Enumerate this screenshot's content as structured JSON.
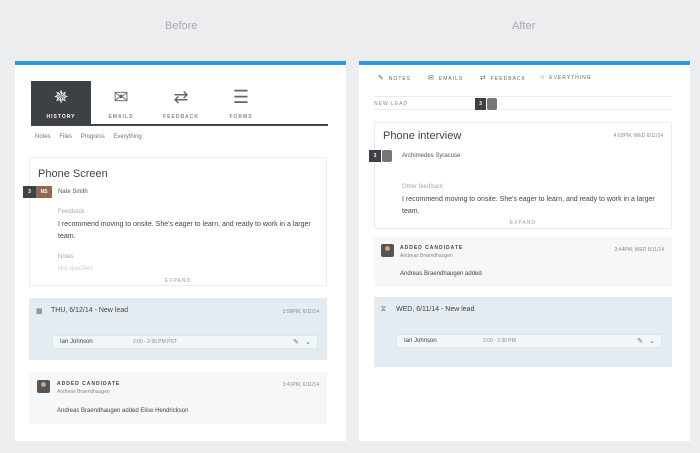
{
  "captions": {
    "before": "Before",
    "after": "After"
  },
  "before": {
    "tabs": [
      {
        "label": "HISTORY",
        "icon": "spinner-icon"
      },
      {
        "label": "EMAILS",
        "icon": "envelope-icon"
      },
      {
        "label": "FEEDBACK",
        "icon": "arrows-swap-icon"
      },
      {
        "label": "FORMS",
        "icon": "list-icon"
      }
    ],
    "subnav": [
      "Notes",
      "Files",
      "Progress",
      "Everything"
    ],
    "interview": {
      "title": "Phone Screen",
      "badge_count": "3",
      "badge_initials": "NS",
      "interviewer": "Nate Smith",
      "feedback_label": "Feedback",
      "feedback_text": "I recommend moving to onsite. She's eager to learn, and ready to work in a larger team.",
      "notes_label": "Notes",
      "notes_value": "Not specified",
      "expand": "EXPAND"
    },
    "event": {
      "title": "THU, 6/12/14 - New lead",
      "time": "3:59PM, 6/11/14",
      "slot_name": "Ian Johnson",
      "slot_time": "2:00 - 2:30 PM PST"
    },
    "feed": {
      "head": "ADDED CANDIDATE",
      "sub": "Andreas Braendhaugen",
      "time": "3:41PM, 6/11/14",
      "text": "Andreas Braendhaugen added Elise Hendrickson"
    }
  },
  "after": {
    "tabs": [
      {
        "label": "NOTES",
        "icon": "pencil-icon"
      },
      {
        "label": "EMAILS",
        "icon": "envelope-icon"
      },
      {
        "label": "FEEDBACK",
        "icon": "arrows-swap-icon"
      },
      {
        "label": "EVERYTHING",
        "icon": "circle-icon"
      }
    ],
    "new_lead": {
      "label": "NEW LEAD",
      "count": "3"
    },
    "interview": {
      "title": "Phone interview",
      "time": "4:02PM, WED 6/11/14",
      "badge_count": "3",
      "interviewer": "Archimedes Syracuse",
      "feedback_label": "Other feedback",
      "feedback_text": "I recommend moving to onsite. She's eager to learn, and ready to work in a larger team.",
      "expand": "EXPAND"
    },
    "feed": {
      "head": "ADDED CANDIDATE",
      "sub": "Andreas Braendhaugen",
      "time": "3:44PM, WED 6/11/14",
      "text": "Andreas Braendhaugen added"
    },
    "event": {
      "title": "WED, 6/11/14 - New lead",
      "slot_name": "Ian Johnson",
      "slot_time": "2:00 - 2:30 PM"
    }
  },
  "colors": {
    "accent": "#2a9bd8",
    "active_tab": "#3d4145",
    "event_bg": "#e4ecf1"
  }
}
